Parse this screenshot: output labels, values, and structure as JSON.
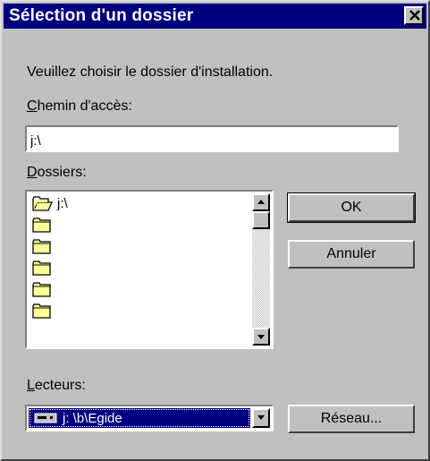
{
  "window": {
    "title": "Sélection d'un dossier"
  },
  "instruction": "Veuillez choisir le dossier d'installation.",
  "path": {
    "label_hotkey": "C",
    "label_rest": "hemin d'accès:",
    "value": "j:\\"
  },
  "folders": {
    "label_hotkey": "D",
    "label_rest": "ossiers:",
    "items": [
      {
        "name": "j:\\",
        "icon": "open-folder-icon"
      },
      {
        "name": "",
        "icon": "folder-icon"
      },
      {
        "name": "",
        "icon": "folder-icon"
      },
      {
        "name": "",
        "icon": "folder-icon"
      },
      {
        "name": "",
        "icon": "folder-icon"
      },
      {
        "name": "",
        "icon": "folder-icon"
      }
    ]
  },
  "buttons": {
    "ok": "OK",
    "cancel": "Annuler",
    "network": "Réseau..."
  },
  "drives": {
    "label_hotkey": "L",
    "label_rest": "ecteurs:",
    "selected": "j: \\b\\Egide",
    "icon": "network-drive-icon"
  },
  "colors": {
    "titlebar": "#000080",
    "face": "#c0c0c0",
    "folder": "#ffff99"
  }
}
